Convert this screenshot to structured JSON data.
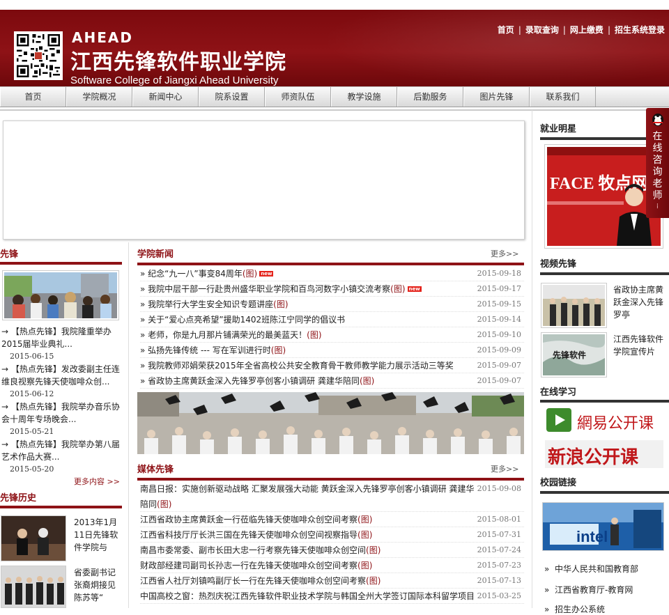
{
  "header": {
    "brand_en": "AHEAD",
    "brand_cn": "江西先锋软件职业学院",
    "brand_sub": "Software College of Jiangxi Ahead University",
    "top_links": [
      "首页",
      "录取查询",
      "网上缴费",
      "招生系统登录"
    ]
  },
  "nav": [
    "首页",
    "学院概况",
    "新闻中心",
    "院系设置",
    "师资队伍",
    "教学设施",
    "后勤服务",
    "图片先锋",
    "联系我们"
  ],
  "left": {
    "pioneer_title": "先锋",
    "pioneer_items": [
      {
        "title": "【热点先锋】我院隆重举办2015届毕业典礼...",
        "date": "2015-06-15"
      },
      {
        "title": "【热点先锋】发改委副主任连维良视察先锋天使咖啡众创...",
        "date": "2015-06-12"
      },
      {
        "title": "【热点先锋】我院举办音乐协会十周年专场晚会...",
        "date": "2015-05-21"
      },
      {
        "title": "【热点先锋】我院举办第八届艺术作品大赛...",
        "date": "2015-05-20"
      }
    ],
    "more_label": "更多内容 >>",
    "history_title": "先锋历史",
    "history_items": [
      "2013年1月11日先锋软件学院与",
      "省委副书记张裔炯接见陈苏等“"
    ]
  },
  "news": {
    "title": "学院新闻",
    "more": "更多>>",
    "pic_tag": "(图)",
    "new_tag": "new",
    "items": [
      {
        "title": "纪念“九一八”事变84周年",
        "pic": true,
        "new": true,
        "date": "2015-09-18"
      },
      {
        "title": "我院中层干部一行赴贵州盛华职业学院和百鸟河数字小镇交流考察",
        "pic": true,
        "new": true,
        "date": "2015-09-17"
      },
      {
        "title": "我院举行大学生安全知识专题讲座",
        "pic": true,
        "new": false,
        "date": "2015-09-15"
      },
      {
        "title": "关于“爱心点亮希望”援助1402班陈江宁同学的倡议书",
        "pic": false,
        "new": false,
        "date": "2015-09-14"
      },
      {
        "title": "老师，你是九月那片铺满荣光的最美蓝天！",
        "pic": true,
        "new": false,
        "date": "2015-09-10"
      },
      {
        "title": "弘扬先锋传统 --- 写在军训进行时",
        "pic": true,
        "new": false,
        "date": "2015-09-09"
      },
      {
        "title": "我院教师邓娟荣获2015年全省高校公共安全教育骨干教师教学能力展示活动三等奖",
        "pic": false,
        "new": false,
        "date": "2015-09-07"
      },
      {
        "title": "省政协主席黄跃金深入先锋罗亭创客小镇调研 龚建华陪同",
        "pic": true,
        "new": false,
        "date": "2015-09-07"
      }
    ]
  },
  "media": {
    "title": "媒体先锋",
    "more": "更多>>",
    "items": [
      {
        "title": "南昌日报：实施创新驱动战略 汇聚发展强大动能 黄跃金深入先锋罗亭创客小镇调研 龚建华陪同",
        "pic": true,
        "date": "2015-09-08"
      },
      {
        "title": "江西省政协主席黄跃金一行莅临先锋天使咖啡众创空间考察",
        "pic": true,
        "date": "2015-08-01"
      },
      {
        "title": "江西省科技厅厅长洪三国在先锋天使咖啡众创空间视察指导",
        "pic": true,
        "date": "2015-07-31"
      },
      {
        "title": "南昌市委常委、副市长田大忠一行考察先锋天使咖啡众创空间",
        "pic": true,
        "date": "2015-07-24"
      },
      {
        "title": "财政部经建司副司长孙志一行在先锋天使咖啡众创空间考察",
        "pic": true,
        "date": "2015-07-23"
      },
      {
        "title": "江西省人社厅刘镇鸣副厅长一行在先锋天使咖啡众创空间考察",
        "pic": true,
        "date": "2015-07-13"
      },
      {
        "title": "中国高校之窗：热烈庆祝江西先锋软件职业技术学院与韩国全州大学签订国际本科留学项目",
        "pic": false,
        "date": "2015-03-25"
      }
    ]
  },
  "right": {
    "employ_title": "就业明星",
    "employ_sign": "FACE 牧点网",
    "video_title": "视频先锋",
    "videos": [
      "省政协主席黄跃金深入先锋罗亭",
      "江西先锋软件学院宣传片"
    ],
    "video_logo": "先锋软件",
    "study_title": "在线学习",
    "study_items": [
      "網易公开课",
      "新浪公开课"
    ],
    "links_title": "校园链接",
    "intel_text": "intel",
    "links": [
      "中华人民共和国教育部",
      "江西省教育厅-教育网",
      "招生办公系统"
    ]
  },
  "qq": {
    "label": "在线咨询老师"
  },
  "colors": {
    "brand": "#8e1216",
    "nav_bg": "#e6e6e6",
    "new_badge": "#e4231b"
  }
}
